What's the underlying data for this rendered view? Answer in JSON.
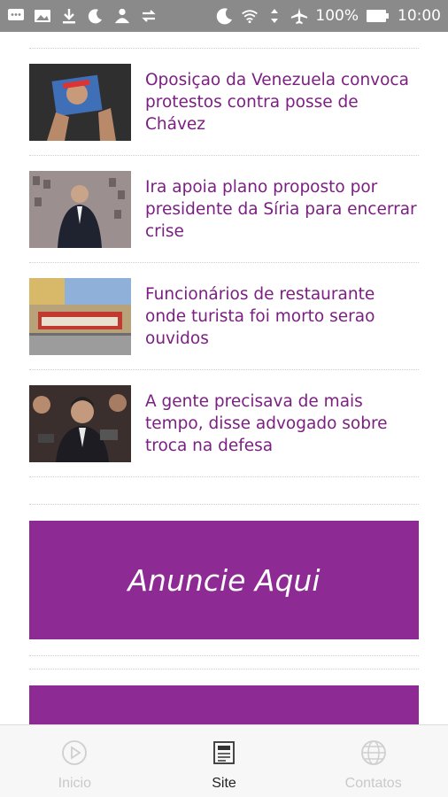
{
  "status_bar": {
    "battery_percent": "100%",
    "time": "10:00",
    "left_icons": [
      "message-icon",
      "image-icon",
      "download-icon",
      "moon-icon",
      "person-icon",
      "sync-icon"
    ],
    "right_icons": [
      "moon-icon",
      "wifi-icon",
      "vibrate-icon",
      "airplane-icon",
      "battery-icon"
    ]
  },
  "news": [
    {
      "title": "Oposiçao da Venezuela convoca protestos contra posse de Chávez",
      "image": "photo"
    },
    {
      "title": "Ira apoia plano proposto por presidente da Síria para encerrar crise",
      "image": "photo"
    },
    {
      "title": "Funcionários de restaurante onde turista foi morto serao ouvidos",
      "image": "photo"
    },
    {
      "title": "A gente precisava de mais tempo, disse advogado sobre troca na defesa",
      "image": "photo"
    }
  ],
  "ad": {
    "label": "Anuncie Aqui",
    "color": "#8d2a93"
  },
  "bottom_nav": [
    {
      "label": "Inicio",
      "icon": "play-icon",
      "active": false
    },
    {
      "label": "Site",
      "icon": "newspaper-icon",
      "active": true
    },
    {
      "label": "Contatos",
      "icon": "globe-icon",
      "active": false
    }
  ],
  "colors": {
    "accent": "#7b1f82",
    "status_bar": "#8a8a8a"
  }
}
